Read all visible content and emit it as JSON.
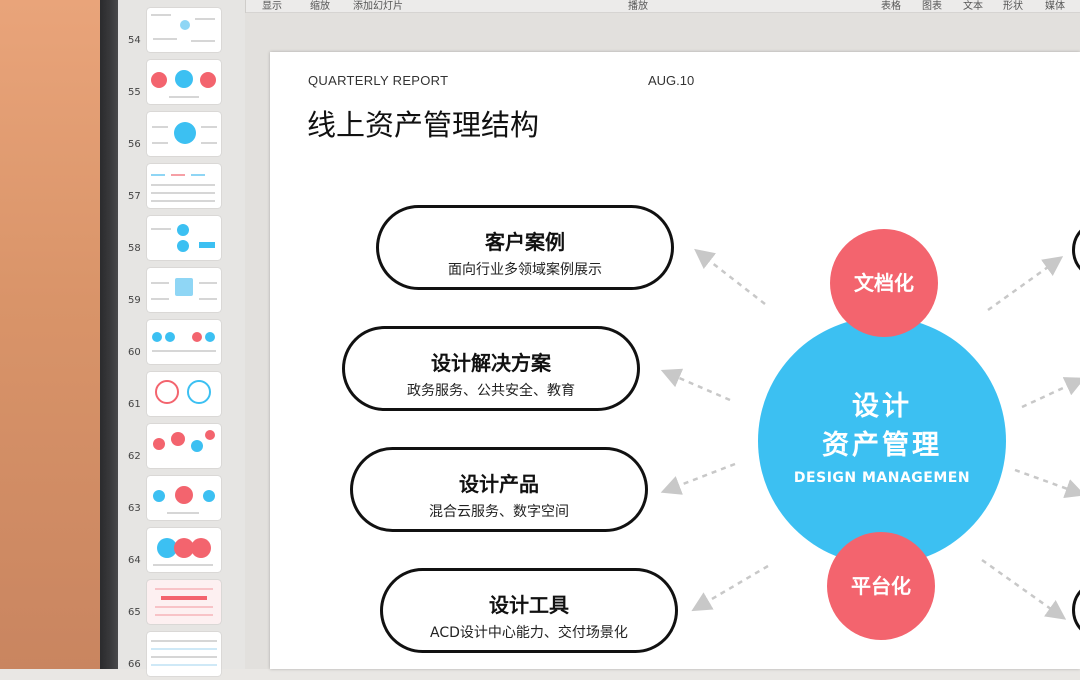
{
  "toolbar": {
    "items": [
      "显示",
      "缩放",
      "添加幻灯片",
      "播放",
      "表格",
      "图表",
      "文本",
      "形状",
      "媒体"
    ]
  },
  "sidebar": {
    "slide_numbers": [
      "54",
      "55",
      "56",
      "57",
      "58",
      "59",
      "60",
      "61",
      "62",
      "63",
      "64",
      "65",
      "66"
    ]
  },
  "slide": {
    "report_label": "QUARTERLY REPORT",
    "date": "AUG.10",
    "title": "线上资产管理结构",
    "pills": [
      {
        "title": "客户案例",
        "subtitle": "面向行业多领域案例展示"
      },
      {
        "title": "设计解决方案",
        "subtitle": "政务服务、公共安全、教育"
      },
      {
        "title": "设计产品",
        "subtitle": "混合云服务、数字空间"
      },
      {
        "title": "设计工具",
        "subtitle": "ACD设计中心能力、交付场景化"
      }
    ],
    "center": {
      "line1": "设计",
      "line2": "资产管理",
      "english": "DESIGN MANAGEMEN"
    },
    "top_circle": "文档化",
    "bottom_circle": "平台化"
  },
  "colors": {
    "accent_blue": "#3cc0f2",
    "accent_red": "#f3646e",
    "arrow_gray": "#c8c8c8"
  }
}
